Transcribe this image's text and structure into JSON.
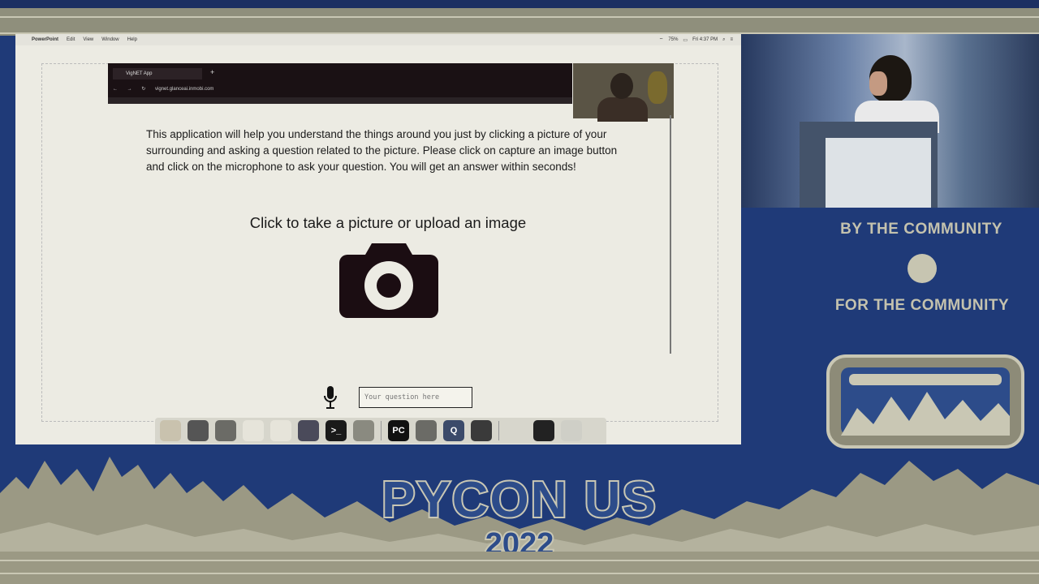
{
  "menubar": {
    "app_name": "PowerPoint",
    "items": [
      "Edit",
      "View",
      "Window",
      "Help"
    ],
    "battery": "75%",
    "clock": "Fri 4:37 PM"
  },
  "browser": {
    "tab_title": "VigNET App",
    "url": "vignet.glanceai.inmobi.com"
  },
  "app": {
    "description": "This application will help you understand the things around you just by clicking a picture of your surrounding and asking a question related to the picture. Please click on capture an image button and click on the microphone to ask your question. You will get an answer within seconds!",
    "cta": "Click to take a picture or upload an image",
    "question_placeholder": "Your question here"
  },
  "dock": {
    "apps": [
      {
        "icon": "finder-icon",
        "color": "#c9c2ae",
        "label": ""
      },
      {
        "icon": "safari-icon",
        "color": "#555555",
        "label": ""
      },
      {
        "icon": "chrome-icon",
        "color": "#6b6b66",
        "label": ""
      },
      {
        "icon": "notes-icon",
        "color": "#e6e4da",
        "label": ""
      },
      {
        "icon": "document-icon",
        "color": "#e6e4da",
        "label": ""
      },
      {
        "icon": "teams-icon",
        "color": "#4a4a5a",
        "label": ""
      },
      {
        "icon": "terminal-icon",
        "color": "#1a1a1a",
        "label": ">_"
      },
      {
        "icon": "pdf-icon",
        "color": "#8a8a80",
        "label": ""
      },
      {
        "icon": "pycharm-icon",
        "color": "#111111",
        "label": "PC"
      },
      {
        "icon": "settings-icon",
        "color": "#6b6b66",
        "label": ""
      },
      {
        "icon": "quicktime-icon",
        "color": "#3b4a6a",
        "label": "Q"
      },
      {
        "icon": "preview-icon",
        "color": "#3a3a3a",
        "label": ""
      },
      {
        "icon": "folder-icon",
        "color": "#d7d6cc",
        "label": ""
      },
      {
        "icon": "screen-icon",
        "color": "#222222",
        "label": ""
      },
      {
        "icon": "trash-icon",
        "color": "#cfcfc7",
        "label": ""
      }
    ]
  },
  "conference": {
    "tagline_top": "BY THE COMMUNITY",
    "tagline_bottom": "FOR THE COMMUNITY",
    "event": "PYCON US",
    "year": "2022"
  },
  "colors": {
    "navy": "#1f3a78",
    "sand": "#c9c7b4",
    "screen_bg": "#ecebe3"
  }
}
